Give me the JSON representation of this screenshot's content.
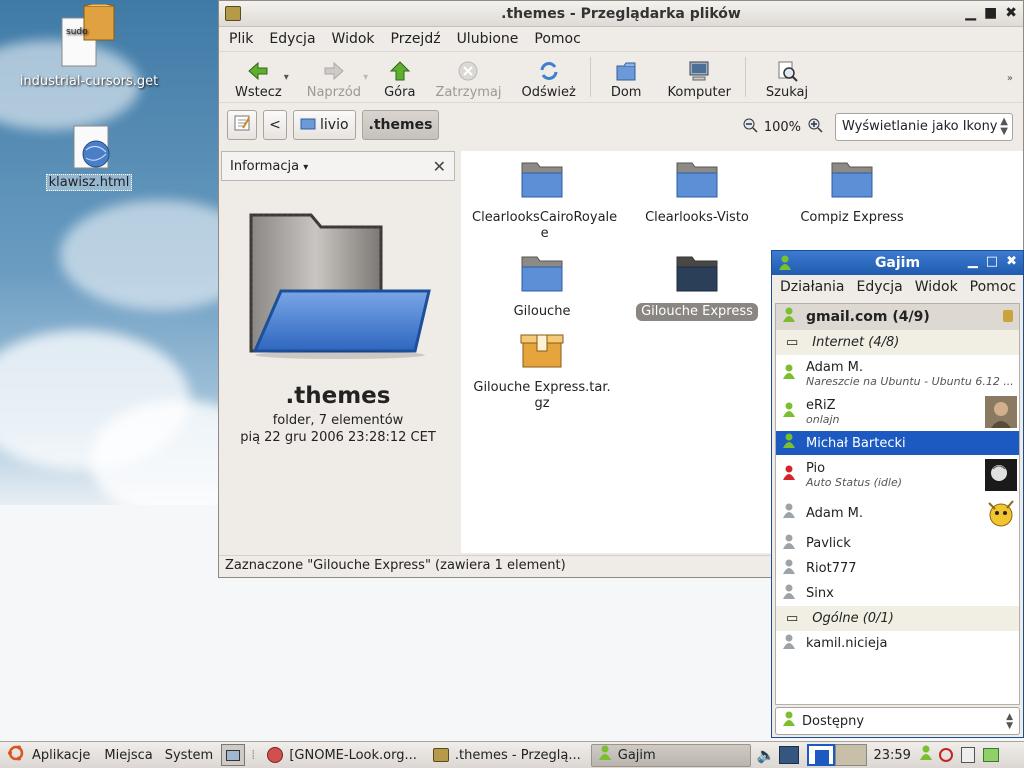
{
  "desktop": {
    "icons": [
      {
        "label": "industrial-cursors.get",
        "badge": "sudo",
        "selected": false
      },
      {
        "label": "klawisz.html",
        "selected": true
      }
    ]
  },
  "nautilus": {
    "title": ".themes - Przeglądarka plików",
    "menu": [
      "Plik",
      "Edycja",
      "Widok",
      "Przejdź",
      "Ulubione",
      "Pomoc"
    ],
    "toolbar": {
      "back": "Wstecz",
      "forward": "Naprzód",
      "up": "Góra",
      "stop": "Zatrzymaj",
      "reload": "Odśwież",
      "home": "Dom",
      "computer": "Komputer",
      "search": "Szukaj"
    },
    "path": {
      "prev": "<",
      "crumb1": "livio",
      "crumb2": ".themes"
    },
    "zoom": "100%",
    "view_mode": "Wyświetlanie jako Ikony",
    "sidepane": {
      "header": "Informacja",
      "name": ".themes",
      "kind": "folder, 7 elementów",
      "date": "pią 22 gru 2006 23:28:12 CET"
    },
    "files": [
      {
        "name": "ClearlooksCairoRoyale",
        "name2": "e"
      },
      {
        "name": "Clearlooks-Visto"
      },
      {
        "name": "Compiz Express"
      },
      {
        "name": "Gilouche"
      },
      {
        "name": "Gilouche Express",
        "selected": true
      },
      {
        "name": "Gilouche Express.tar.",
        "name2": "gz"
      }
    ],
    "status": "Zaznaczone \"Gilouche Express\" (zawiera 1 element)"
  },
  "gajim": {
    "title": "Gajim",
    "menu": [
      "Działania",
      "Edycja",
      "Widok",
      "Pomoc"
    ],
    "account": "gmail.com (4/9)",
    "groups": [
      {
        "name": "Internet (4/8)"
      },
      {
        "name": "Ogólne (0/1)"
      }
    ],
    "contacts": [
      {
        "name": "Adam M.",
        "status": "Nareszcie na Ubuntu - Ubuntu 6.12 ...",
        "presence": "online"
      },
      {
        "name": "eRiZ",
        "status": "onlajn",
        "presence": "online"
      },
      {
        "name": "Michał Bartecki",
        "status": "",
        "presence": "online",
        "selected": true
      },
      {
        "name": "Pio",
        "status": "Auto Status (idle)",
        "presence": "away"
      },
      {
        "name": "Adam M.",
        "status": "",
        "presence": "offline"
      },
      {
        "name": "Pavlick",
        "status": "",
        "presence": "offline"
      },
      {
        "name": "Riot777",
        "status": "",
        "presence": "offline"
      },
      {
        "name": "Sinx",
        "status": "",
        "presence": "offline"
      },
      {
        "name": "kamil.nicieja",
        "status": "",
        "presence": "offline"
      }
    ],
    "presence_select": "Dostępny"
  },
  "panel": {
    "apps": "Aplikacje",
    "places": "Miejsca",
    "system": "System",
    "tasks": [
      "[GNOME-Look.org...",
      ".themes - Przeglą...",
      "Gajim"
    ],
    "clock": "23:59"
  },
  "colors": {
    "selection_blue": "#1c5ac2",
    "gajim_title": "#2a67be",
    "folder_blue": "#5c8fd6",
    "online_green": "#7bbf2e",
    "away_red": "#d6242a"
  }
}
